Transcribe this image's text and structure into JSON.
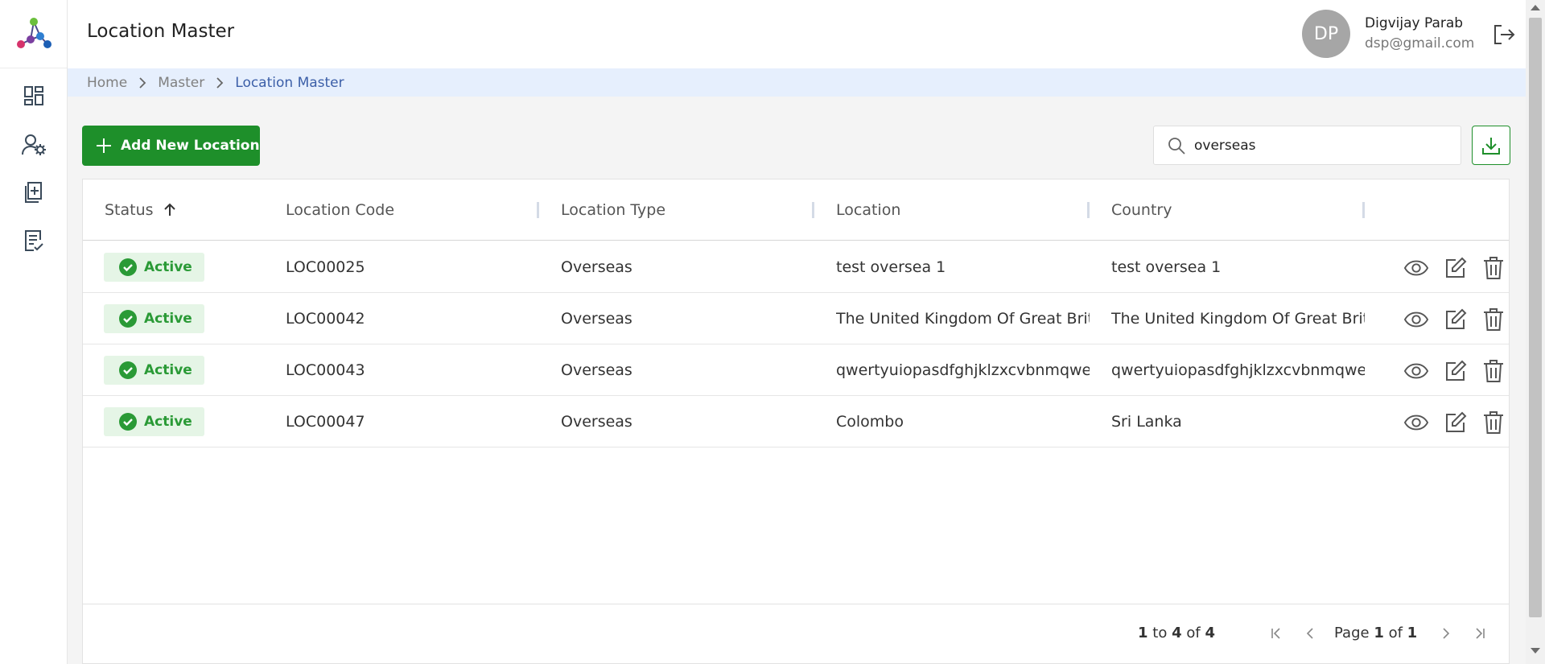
{
  "header": {
    "title": "Location Master",
    "user": {
      "initials": "DP",
      "name": "Digvijay Parab",
      "email": "dsp@gmail.com"
    }
  },
  "sidebar": {
    "items": [
      {
        "icon": "dashboard-icon"
      },
      {
        "icon": "user-settings-icon"
      },
      {
        "icon": "add-document-icon"
      },
      {
        "icon": "checklist-icon"
      }
    ]
  },
  "breadcrumb": [
    "Home",
    "Master",
    "Location Master"
  ],
  "toolbar": {
    "add_label": "Add New Location",
    "search_value": "overseas"
  },
  "table": {
    "columns": [
      "Status",
      "Location Code",
      "Location Type",
      "Location",
      "Country"
    ],
    "sort": {
      "column": "Status",
      "direction": "asc"
    },
    "rows": [
      {
        "status": "Active",
        "code": "LOC00025",
        "type": "Overseas",
        "location": "test oversea 1",
        "country": "test oversea 1"
      },
      {
        "status": "Active",
        "code": "LOC00042",
        "type": "Overseas",
        "location": "The United Kingdom Of Great Britain",
        "country": "The United Kingdom Of Great Britain"
      },
      {
        "status": "Active",
        "code": "LOC00043",
        "type": "Overseas",
        "location": "qwertyuiopasdfghjklzxcvbnmqwertyuiop",
        "country": "qwertyuiopasdfghjklzxcvbnmqwertyuiop"
      },
      {
        "status": "Active",
        "code": "LOC00047",
        "type": "Overseas",
        "location": "Colombo",
        "country": "Sri Lanka"
      }
    ]
  },
  "pagination": {
    "from": "1",
    "to_word": "to",
    "to": "4",
    "of_word": "of",
    "total": "4",
    "page_word": "Page",
    "page": "1",
    "page_of_word": "of",
    "pages": "1"
  },
  "colors": {
    "primary_green": "#1e8f2a",
    "active_badge_bg": "#e5f5e6",
    "breadcrumb_bg": "#e6effd",
    "breadcrumb_current": "#3c5fa8"
  }
}
